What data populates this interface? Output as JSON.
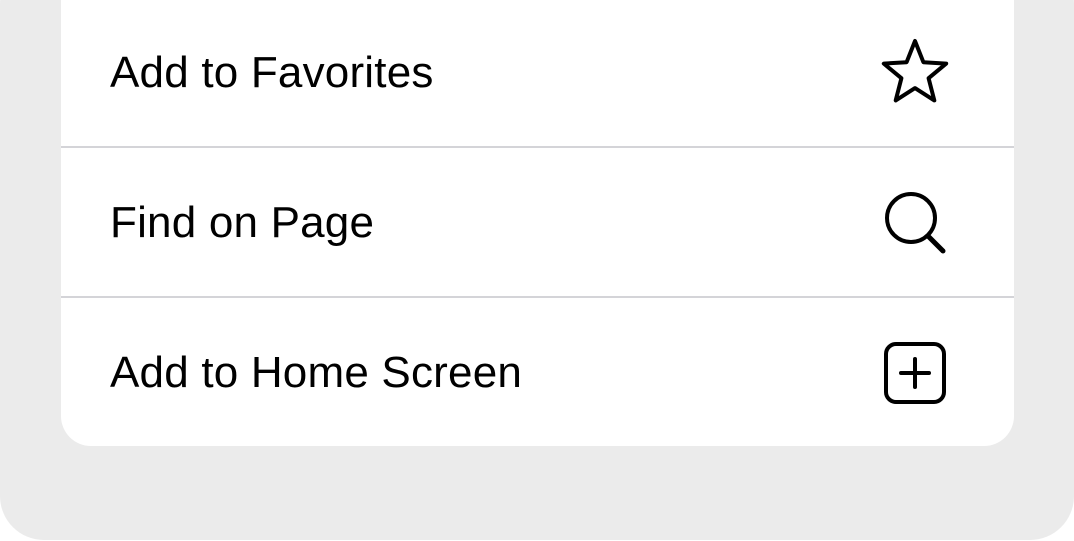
{
  "menu": {
    "items": [
      {
        "label": "Add to Favorites",
        "icon": "star-icon"
      },
      {
        "label": "Find on Page",
        "icon": "search-icon"
      },
      {
        "label": "Add to Home Screen",
        "icon": "add-square-icon"
      }
    ]
  },
  "colors": {
    "sheet_background": "#ebebeb",
    "card_background": "#ffffff",
    "separator": "#d4d4d8",
    "text": "#000000",
    "icon": "#000000"
  }
}
